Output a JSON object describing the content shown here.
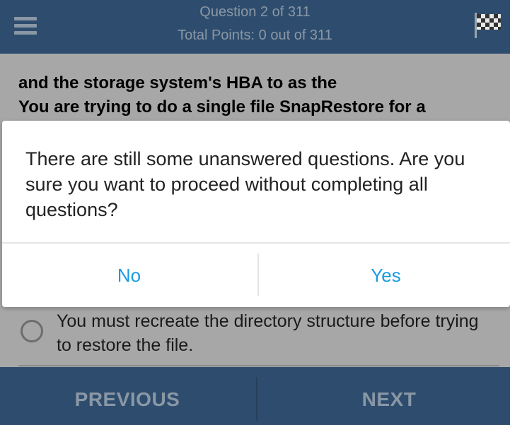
{
  "header": {
    "question_counter": "Question 2 of 311",
    "points": "Total Points: 0 out of 311",
    "menu_icon": "hamburger-menu-icon",
    "flag_icon": "checkered-flag-icon"
  },
  "question": {
    "line1": "and the storage system's HBA to as the",
    "line2": "You are trying to do a single file SnapRestore for a"
  },
  "options": [
    {
      "text": "You must recreate the directory structure before trying to restore the file.",
      "selected": false
    }
  ],
  "dialog": {
    "message": "There are still some unanswered questions. Are you sure you want to proceed without completing all questions?",
    "no_label": "No",
    "yes_label": "Yes"
  },
  "footer": {
    "previous_label": "PREVIOUS",
    "next_label": "NEXT"
  },
  "colors": {
    "header_bg": "#2e4d6e",
    "header_text": "#8a97a5",
    "dialog_button": "#1b9be0",
    "overlay_content": "#a7a7a7"
  }
}
